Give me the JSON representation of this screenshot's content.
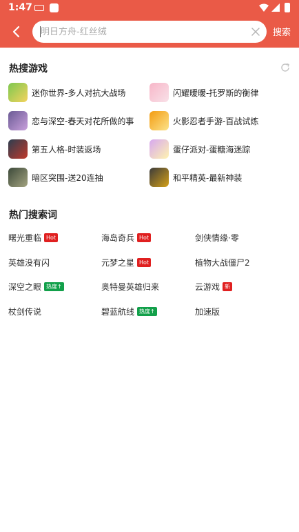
{
  "status_bar": {
    "time": "1:47"
  },
  "search": {
    "placeholder": "明日方舟-红丝绒",
    "button_label": "搜索"
  },
  "hot_games": {
    "title": "热搜游戏",
    "items": [
      {
        "name": "迷你世界-多人对抗大战场",
        "icon_colors": [
          "#7ec850",
          "#f4d35e"
        ]
      },
      {
        "name": "闪耀暖暖-托罗斯的衡律",
        "icon_colors": [
          "#f7b6c8",
          "#f9e1e8"
        ]
      },
      {
        "name": "恋与深空-春天对花所做的事",
        "icon_colors": [
          "#6b5b95",
          "#c9a0dc"
        ]
      },
      {
        "name": "火影忍者手游-百战试炼",
        "icon_colors": [
          "#f39c12",
          "#fce38a"
        ]
      },
      {
        "name": "第五人格-时装返场",
        "icon_colors": [
          "#2c3e50",
          "#c0392b"
        ]
      },
      {
        "name": "蛋仔派对-蛋糖海迷踪",
        "icon_colors": [
          "#d7a8f0",
          "#fff3b0"
        ]
      },
      {
        "name": "暗区突围-送20连抽",
        "icon_colors": [
          "#3d4a3a",
          "#a3a380"
        ]
      },
      {
        "name": "和平精英-最新神装",
        "icon_colors": [
          "#3b3b3b",
          "#d4a017"
        ]
      }
    ]
  },
  "hot_keywords": {
    "title": "热门搜索词",
    "items": [
      {
        "text": "曙光重临",
        "tag": "Hot",
        "tag_type": "hot"
      },
      {
        "text": "海岛奇兵",
        "tag": "Hot",
        "tag_type": "hot"
      },
      {
        "text": "剑侠情缘·零",
        "tag": "",
        "tag_type": ""
      },
      {
        "text": "英雄没有闪",
        "tag": "",
        "tag_type": ""
      },
      {
        "text": "元梦之星",
        "tag": "Hot",
        "tag_type": "hot"
      },
      {
        "text": "植物大战僵尸2",
        "tag": "",
        "tag_type": ""
      },
      {
        "text": "深空之眼",
        "tag": "热度↑",
        "tag_type": "heat"
      },
      {
        "text": "奥特曼英雄归来",
        "tag": "",
        "tag_type": ""
      },
      {
        "text": "云游戏",
        "tag": "新",
        "tag_type": "new"
      },
      {
        "text": "杖剑传说",
        "tag": "",
        "tag_type": ""
      },
      {
        "text": "碧蓝航线",
        "tag": "热度↑",
        "tag_type": "heat"
      },
      {
        "text": "加速版",
        "tag": "",
        "tag_type": ""
      }
    ]
  },
  "colors": {
    "header": "#ea5a47",
    "hot_tag": "#e02020",
    "heat_tag": "#12a04a"
  }
}
